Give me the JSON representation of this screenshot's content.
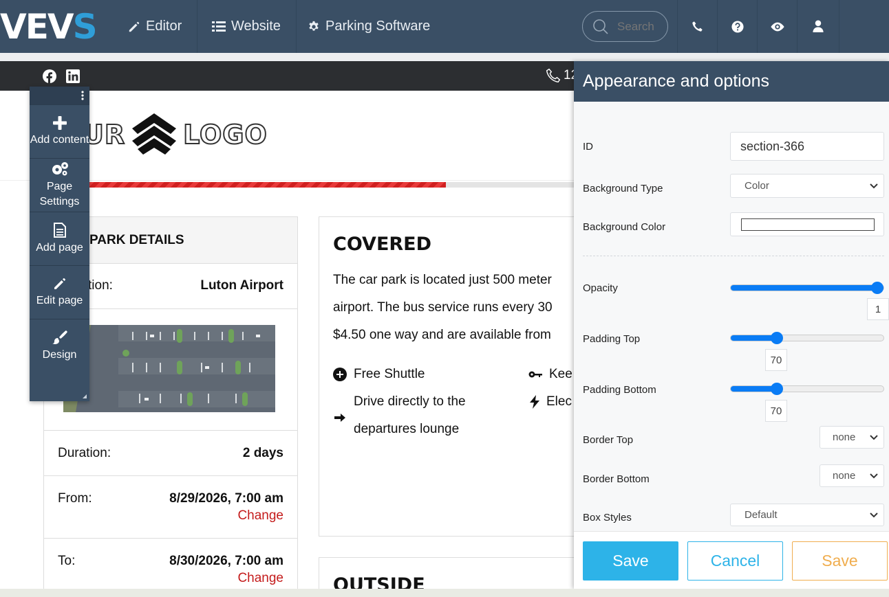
{
  "topbar": {
    "logo_main": "VEV",
    "logo_accent": "S",
    "nav": [
      {
        "label": "Editor",
        "icon": "pencil-icon"
      },
      {
        "label": "Website",
        "icon": "list-icon"
      },
      {
        "label": "Parking Software",
        "icon": "gear-icon"
      }
    ],
    "search_placeholder": "Search",
    "icons": [
      "phone-icon",
      "help-icon",
      "eye-icon",
      "user-icon"
    ],
    "bg_color": "#3a4f65"
  },
  "site": {
    "phone_partial": "12",
    "logo_left": "UR",
    "logo_right": "LOGO",
    "booking_progress_fraction": 0.74
  },
  "toolbox": {
    "items": [
      {
        "label": "Add content",
        "icon": "plus-icon"
      },
      {
        "label": "Page Settings",
        "icon": "cogs-icon"
      },
      {
        "label": "Add page",
        "icon": "document-icon"
      },
      {
        "label": "Edit page",
        "icon": "pencil-icon"
      },
      {
        "label": "Design",
        "icon": "brush-icon"
      }
    ]
  },
  "details": {
    "title": "PARK DETAILS",
    "location_label": "tion:",
    "location_value": "Luton Airport",
    "duration_label": "Duration:",
    "duration_value": "2 days",
    "from_label": "From:",
    "from_value": "8/29/2026, 7:00 am",
    "to_label": "To:",
    "to_value": "8/30/2026, 7:00 am",
    "change_label": "Change"
  },
  "covered": {
    "title": "COVERED",
    "lines": [
      "The car park is located just 500 meter",
      "airport. The bus service runs every 30",
      "$4.50 one way and are available from"
    ],
    "features": [
      {
        "text": "Free Shuttle",
        "icon": "plus-circle-icon"
      },
      {
        "text": "Kee",
        "icon": "key-icon"
      },
      {
        "text": "Drive directly to the",
        "icon": "arrow-right-icon"
      },
      {
        "text": "departures lounge",
        "icon": ""
      },
      {
        "text": "Elec",
        "icon": "bolt-icon"
      }
    ]
  },
  "outside": {
    "title": "OUTSIDE"
  },
  "panel": {
    "title": "Appearance and options",
    "id_label": "ID",
    "id_value": "section-366",
    "bg_type_label": "Background Type",
    "bg_type_value": "Color",
    "bg_color_label": "Background Color",
    "bg_color_value": "#ffffff",
    "opacity_label": "Opacity",
    "opacity_value": "1",
    "padding_top_label": "Padding Top",
    "padding_top_value": "70",
    "padding_bottom_label": "Padding Bottom",
    "padding_bottom_value": "70",
    "border_top_label": "Border Top",
    "border_top_value": "none",
    "border_bottom_label": "Border Bottom",
    "border_bottom_value": "none",
    "box_styles_label": "Box Styles",
    "box_styles_value": "Default",
    "save_label": "Save",
    "cancel_label": "Cancel",
    "save2_label": "Save",
    "accent": "#2db3e8",
    "warning": "#f0ad4e"
  }
}
